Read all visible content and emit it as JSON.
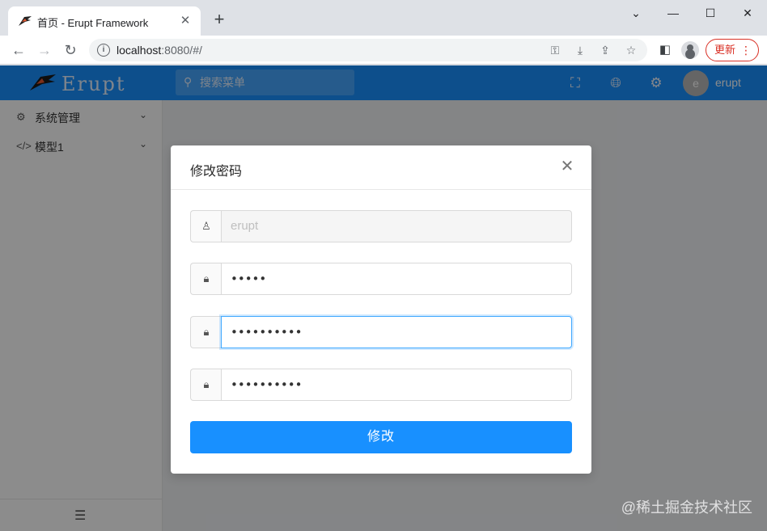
{
  "browser": {
    "tab_title": "首页 - Erupt Framework",
    "tab_close": "✕",
    "new_tab": "+",
    "window_controls": [
      "⌄",
      "—",
      "☐",
      "✕"
    ],
    "url_host": "localhost",
    "url_rest": ":8080/#/",
    "update_label": "更新",
    "update_dots": "⋮"
  },
  "app": {
    "logo_text": "Erupt",
    "search_placeholder": "搜索菜单",
    "user_initial": "e",
    "user_name": "erupt",
    "brand_color": "#1890ff"
  },
  "sidebar": {
    "items": [
      {
        "label": "系统管理",
        "icon": "gears-icon"
      },
      {
        "label": "模型1",
        "icon": "code-icon"
      }
    ]
  },
  "modal": {
    "title": "修改密码",
    "fields": [
      {
        "icon": "user-icon",
        "value": "erupt",
        "disabled": true
      },
      {
        "icon": "lock-icon",
        "value": "•••••"
      },
      {
        "icon": "lock-icon",
        "value": "••••••••••",
        "focused": true
      },
      {
        "icon": "lock-icon",
        "value": "••••••••••"
      }
    ],
    "submit_label": "修改"
  },
  "watermark": "@稀土掘金技术社区"
}
